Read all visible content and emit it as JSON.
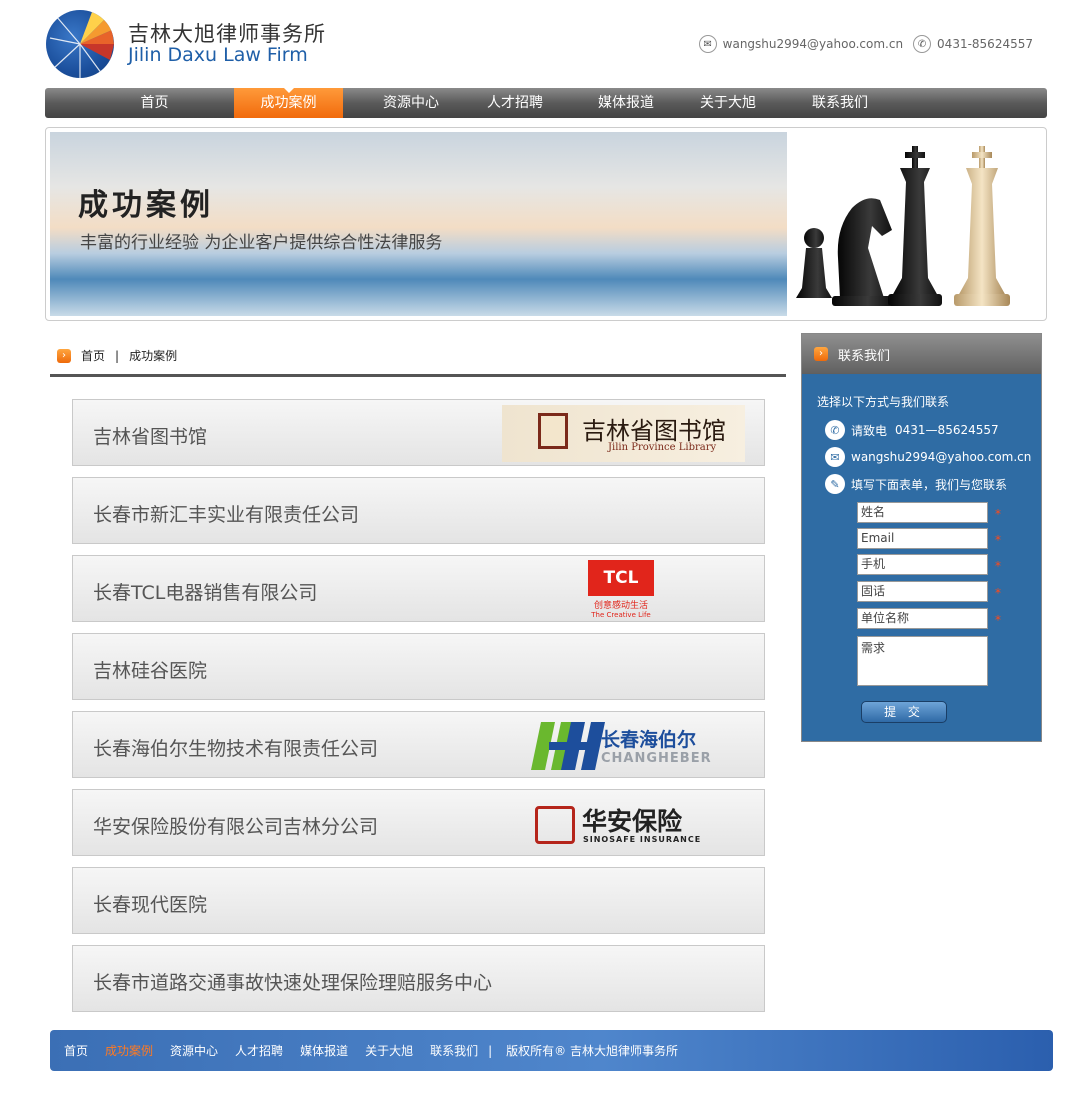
{
  "brand": {
    "name_cn": "吉林大旭律师事务所",
    "name_en": "Jilin Daxu Law Firm"
  },
  "header_contact": {
    "email": "wangshu2994@yahoo.com.cn",
    "phone": "0431-85624557"
  },
  "nav": [
    "首页",
    "成功案例",
    "资源中心",
    "人才招聘",
    "媒体报道",
    "关于大旭",
    "联系我们"
  ],
  "nav_active": "成功案例",
  "banner": {
    "title": "成功案例",
    "subtitle": "丰富的行业经验 为企业客户提供综合性法律服务"
  },
  "breadcrumb": {
    "home": "首页",
    "sep": "|",
    "current": "成功案例"
  },
  "cases": [
    {
      "name": "吉林省图书馆",
      "logo": "吉林省图书馆",
      "logo_sub": "Jilin Province Library"
    },
    {
      "name": "长春市新汇丰实业有限责任公司"
    },
    {
      "name": "长春TCL电器销售有限公司",
      "logo": "TCL",
      "logo_sub": "创意感动生活",
      "logo_sub2": "The Creative Life"
    },
    {
      "name": "吉林硅谷医院"
    },
    {
      "name": "长春海伯尔生物技术有限责任公司",
      "logo": "长春海伯尔",
      "logo_sub": "CHANGHEBER"
    },
    {
      "name": "华安保险股份有限公司吉林分公司",
      "logo": "华安保险",
      "logo_sub": "SINOSAFE  INSURANCE"
    },
    {
      "name": "长春现代医院"
    },
    {
      "name": "长春市道路交通事故快速处理保险理赔服务中心"
    }
  ],
  "sidebar": {
    "title": "联系我们",
    "intro": "选择以下方式与我们联系",
    "phone_label": "请致电",
    "phone": "0431—85624557",
    "email": "wangshu2994@yahoo.com.cn",
    "form_hint": "填写下面表单，我们与您联系",
    "fields": [
      "姓名",
      "Email",
      "手机",
      "固话",
      "单位名称"
    ],
    "required_mark": "*",
    "textarea": "需求",
    "submit": "提 交"
  },
  "footer": {
    "links": [
      "首页",
      "成功案例",
      "资源中心",
      "人才招聘",
      "媒体报道",
      "关于大旭",
      "联系我们"
    ],
    "active": "成功案例",
    "sep": "|",
    "copyright": "版权所有® 吉林大旭律师事务所"
  },
  "colors": {
    "accent_orange": "#f16a0c",
    "sidebar_blue": "#2f6ca4",
    "footer_blue": "#4f86cc",
    "required_red": "#ff4a1a"
  }
}
